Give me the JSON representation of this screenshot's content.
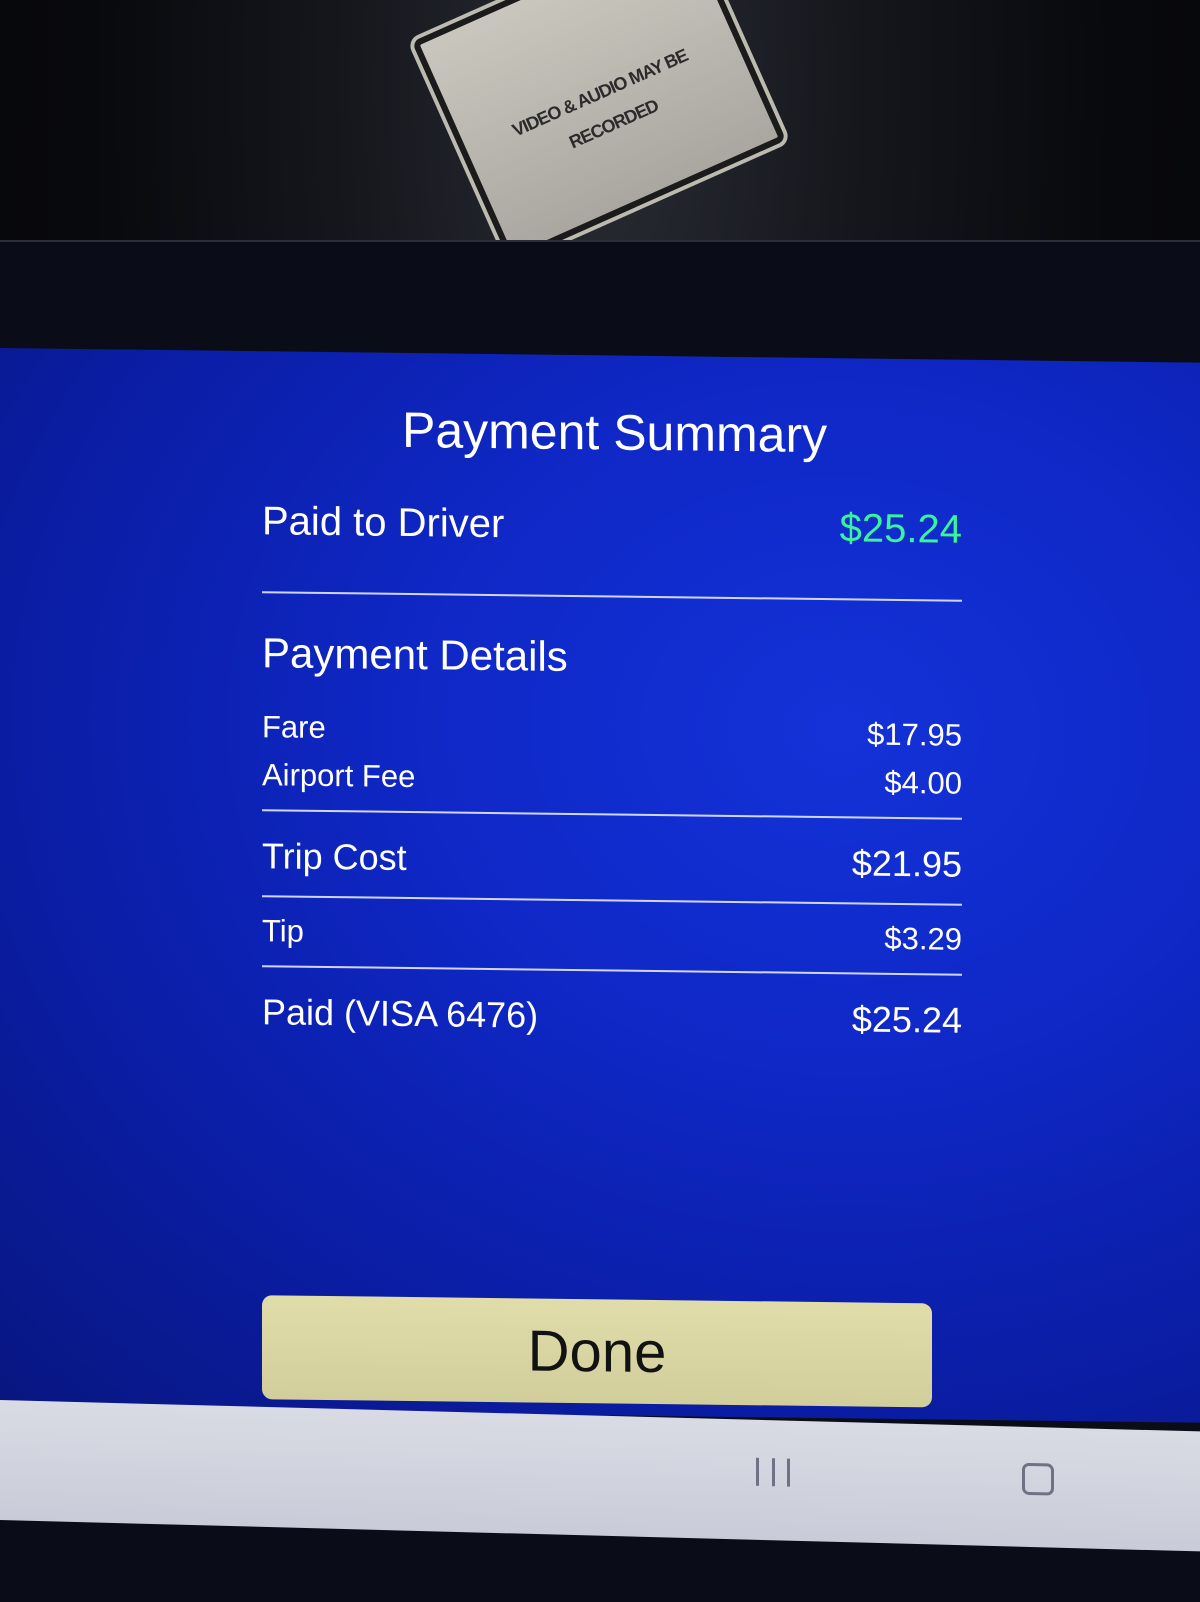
{
  "sticker": {
    "text": "VIDEO & AUDIO MAY BE RECORDED"
  },
  "screen": {
    "title": "Payment Summary",
    "paid_to_driver": {
      "label": "Paid to Driver",
      "amount": "$25.24"
    },
    "details_heading": "Payment Details",
    "fare": {
      "label": "Fare",
      "amount": "$17.95"
    },
    "airport_fee": {
      "label": "Airport Fee",
      "amount": "$4.00"
    },
    "trip_cost": {
      "label": "Trip Cost",
      "amount": "$21.95"
    },
    "tip": {
      "label": "Tip",
      "amount": "$3.29"
    },
    "paid": {
      "label": "Paid (VISA 6476)",
      "amount": "$25.24"
    },
    "done_label": "Done"
  },
  "colors": {
    "screen_blue": "#0f28c6",
    "accent_green": "#3cf29a",
    "button_bg": "#d8d5a3"
  },
  "navbar": {
    "icons": [
      "recent-apps-icon",
      "home-icon"
    ]
  }
}
